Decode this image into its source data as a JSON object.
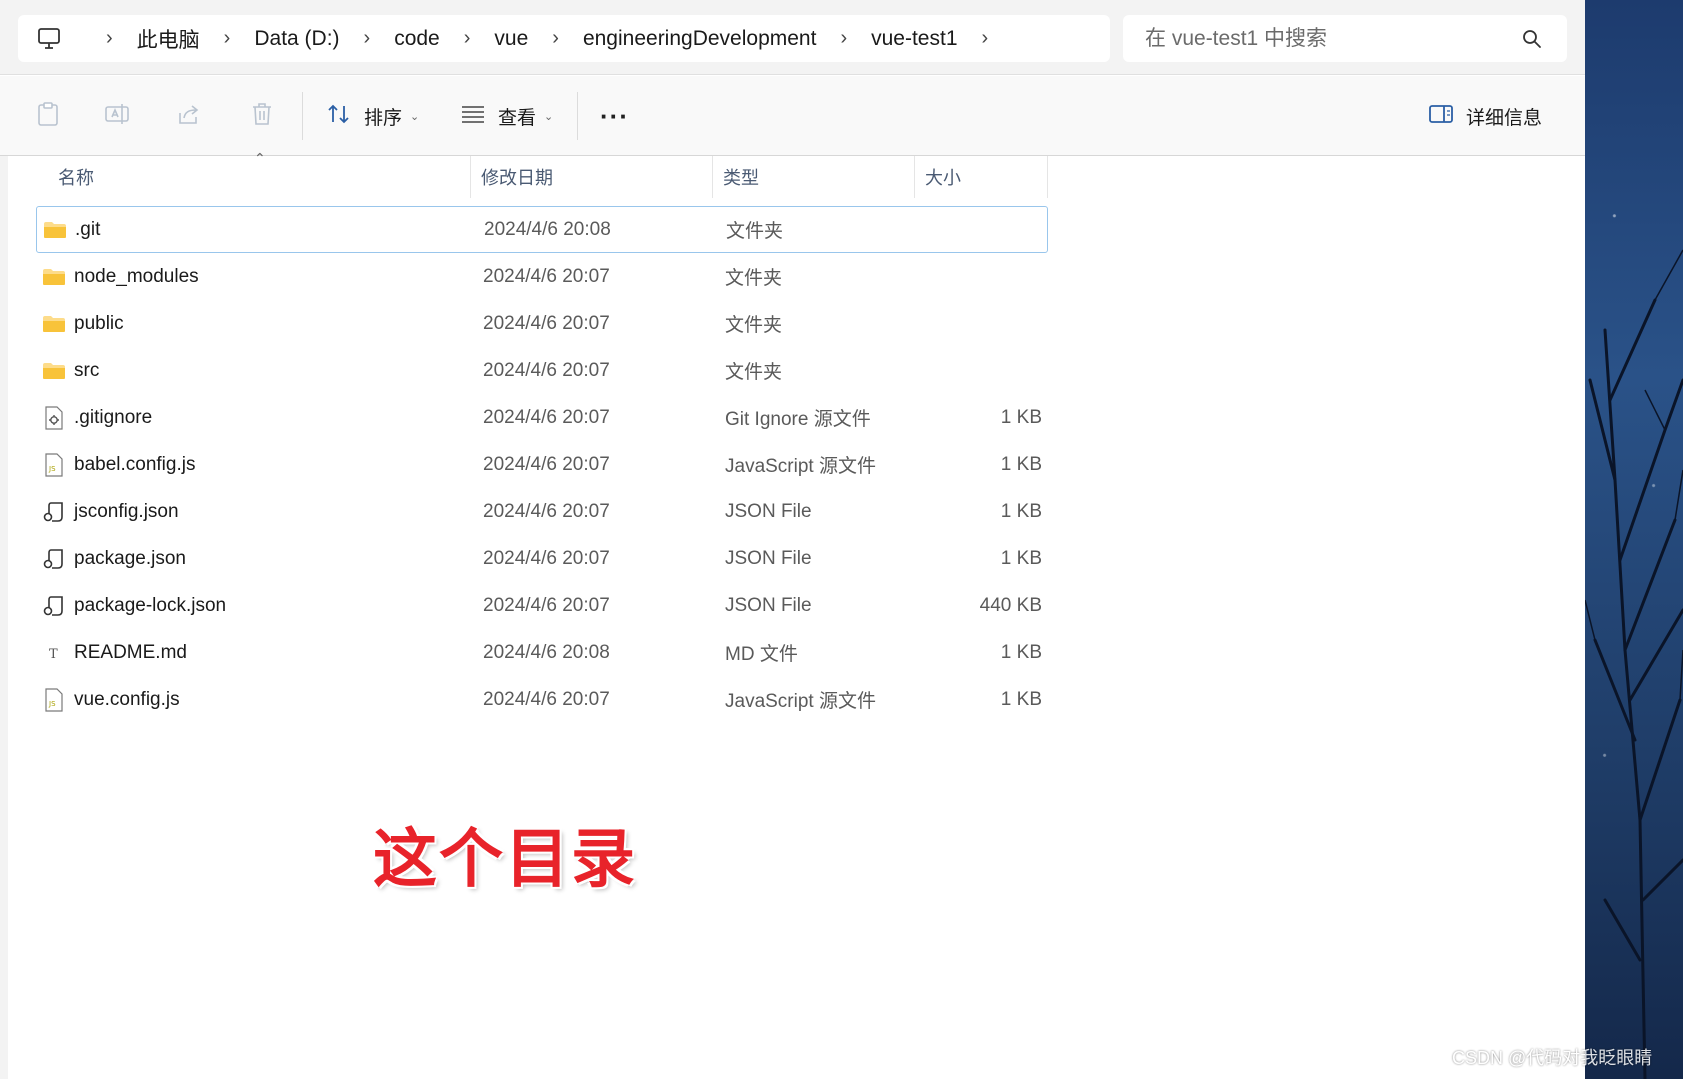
{
  "breadcrumb": {
    "items": [
      "此电脑",
      "Data (D:)",
      "code",
      "vue",
      "engineeringDevelopment",
      "vue-test1"
    ]
  },
  "search": {
    "placeholder": "在 vue-test1 中搜索"
  },
  "toolbar": {
    "sort_label": "排序",
    "view_label": "查看",
    "more_label": "···",
    "details_label": "详细信息"
  },
  "columns": {
    "name": "名称",
    "date": "修改日期",
    "type": "类型",
    "size": "大小"
  },
  "files": [
    {
      "name": ".git",
      "date": "2024/4/6 20:08",
      "type": "文件夹",
      "size": "",
      "icon": "folder-icon"
    },
    {
      "name": "node_modules",
      "date": "2024/4/6 20:07",
      "type": "文件夹",
      "size": "",
      "icon": "folder-icon"
    },
    {
      "name": "public",
      "date": "2024/4/6 20:07",
      "type": "文件夹",
      "size": "",
      "icon": "folder-icon"
    },
    {
      "name": "src",
      "date": "2024/4/6 20:07",
      "type": "文件夹",
      "size": "",
      "icon": "folder-icon"
    },
    {
      "name": ".gitignore",
      "date": "2024/4/6 20:07",
      "type": "Git Ignore 源文件",
      "size": "1 KB",
      "icon": "settings-file-icon"
    },
    {
      "name": "babel.config.js",
      "date": "2024/4/6 20:07",
      "type": "JavaScript 源文件",
      "size": "1 KB",
      "icon": "js-file-icon"
    },
    {
      "name": "jsconfig.json",
      "date": "2024/4/6 20:07",
      "type": "JSON File",
      "size": "1 KB",
      "icon": "json-file-icon"
    },
    {
      "name": "package.json",
      "date": "2024/4/6 20:07",
      "type": "JSON File",
      "size": "1 KB",
      "icon": "json-file-icon"
    },
    {
      "name": "package-lock.json",
      "date": "2024/4/6 20:07",
      "type": "JSON File",
      "size": "440 KB",
      "icon": "json-file-icon"
    },
    {
      "name": "README.md",
      "date": "2024/4/6 20:08",
      "type": "MD 文件",
      "size": "1 KB",
      "icon": "text-file-icon"
    },
    {
      "name": "vue.config.js",
      "date": "2024/4/6 20:07",
      "type": "JavaScript 源文件",
      "size": "1 KB",
      "icon": "js-file-icon"
    }
  ],
  "selected_row": 0,
  "annotation": {
    "text": "这个目录",
    "color": "#e8232a"
  },
  "watermark": "CSDN @代码对我眨眼睛",
  "colors": {
    "folder": "#f8c33a",
    "selection_border": "#99c6ec",
    "header_text": "#4a5a73",
    "accent": "#0067c0"
  }
}
